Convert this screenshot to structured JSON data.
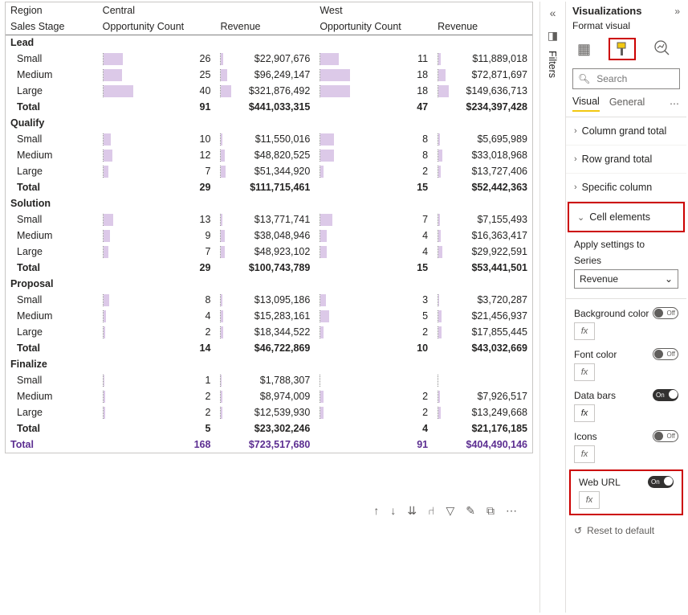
{
  "matrix": {
    "header": {
      "region_label": "Region",
      "salesstage_label": "Sales Stage",
      "regions": [
        "Central",
        "West"
      ],
      "measures": [
        "Opportunity Count",
        "Revenue"
      ]
    },
    "groups": [
      {
        "name": "Lead",
        "rows": [
          {
            "label": "Small",
            "c_opp": 26,
            "c_rev": "$22,907,676",
            "w_opp": 11,
            "w_rev": "$11,889,018",
            "c_opp_pct": 65,
            "c_rev_pct": 22,
            "w_opp_pct": 61,
            "w_rev_pct": 25
          },
          {
            "label": "Medium",
            "c_opp": 25,
            "c_rev": "$96,249,147",
            "w_opp": 18,
            "w_rev": "$72,871,697",
            "c_opp_pct": 63,
            "c_rev_pct": 55,
            "w_opp_pct": 100,
            "w_rev_pct": 70
          },
          {
            "label": "Large",
            "c_opp": 40,
            "c_rev": "$321,876,492",
            "w_opp": 18,
            "w_rev": "$149,636,713",
            "c_opp_pct": 100,
            "c_rev_pct": 100,
            "w_opp_pct": 100,
            "w_rev_pct": 100
          }
        ],
        "total": {
          "label": "Total",
          "c_opp": "91",
          "c_rev": "$441,033,315",
          "w_opp": "47",
          "w_rev": "$234,397,428"
        }
      },
      {
        "name": "Qualify",
        "rows": [
          {
            "label": "Small",
            "c_opp": 10,
            "c_rev": "$11,550,016",
            "w_opp": 8,
            "w_rev": "$5,695,989",
            "c_opp_pct": 25,
            "c_rev_pct": 12,
            "w_opp_pct": 44,
            "w_rev_pct": 12
          },
          {
            "label": "Medium",
            "c_opp": 12,
            "c_rev": "$48,820,525",
            "w_opp": 8,
            "w_rev": "$33,018,968",
            "c_opp_pct": 30,
            "c_rev_pct": 38,
            "w_opp_pct": 44,
            "w_rev_pct": 40
          },
          {
            "label": "Large",
            "c_opp": 7,
            "c_rev": "$51,344,920",
            "w_opp": 2,
            "w_rev": "$13,727,406",
            "c_opp_pct": 18,
            "c_rev_pct": 40,
            "w_opp_pct": 11,
            "w_rev_pct": 20
          }
        ],
        "total": {
          "label": "Total",
          "c_opp": "29",
          "c_rev": "$111,715,461",
          "w_opp": "15",
          "w_rev": "$52,442,363"
        }
      },
      {
        "name": "Solution",
        "rows": [
          {
            "label": "Small",
            "c_opp": 13,
            "c_rev": "$13,771,741",
            "w_opp": 7,
            "w_rev": "$7,155,493",
            "c_opp_pct": 33,
            "c_rev_pct": 14,
            "w_opp_pct": 39,
            "w_rev_pct": 14
          },
          {
            "label": "Medium",
            "c_opp": 9,
            "c_rev": "$38,048,946",
            "w_opp": 4,
            "w_rev": "$16,363,417",
            "c_opp_pct": 23,
            "c_rev_pct": 32,
            "w_opp_pct": 22,
            "w_rev_pct": 25
          },
          {
            "label": "Large",
            "c_opp": 7,
            "c_rev": "$48,923,102",
            "w_opp": 4,
            "w_rev": "$29,922,591",
            "c_opp_pct": 18,
            "c_rev_pct": 38,
            "w_opp_pct": 22,
            "w_rev_pct": 40
          }
        ],
        "total": {
          "label": "Total",
          "c_opp": "29",
          "c_rev": "$100,743,789",
          "w_opp": "15",
          "w_rev": "$53,441,501"
        }
      },
      {
        "name": "Proposal",
        "rows": [
          {
            "label": "Small",
            "c_opp": 8,
            "c_rev": "$13,095,186",
            "w_opp": 3,
            "w_rev": "$3,720,287",
            "c_opp_pct": 20,
            "c_rev_pct": 14,
            "w_opp_pct": 17,
            "w_rev_pct": 10
          },
          {
            "label": "Medium",
            "c_opp": 4,
            "c_rev": "$15,283,161",
            "w_opp": 5,
            "w_rev": "$21,456,937",
            "c_opp_pct": 10,
            "c_rev_pct": 16,
            "w_opp_pct": 28,
            "w_rev_pct": 30
          },
          {
            "label": "Large",
            "c_opp": 2,
            "c_rev": "$18,344,522",
            "w_opp": 2,
            "w_rev": "$17,855,445",
            "c_opp_pct": 5,
            "c_rev_pct": 18,
            "w_opp_pct": 11,
            "w_rev_pct": 28
          }
        ],
        "total": {
          "label": "Total",
          "c_opp": "14",
          "c_rev": "$46,722,869",
          "w_opp": "10",
          "w_rev": "$43,032,669"
        }
      },
      {
        "name": "Finalize",
        "rows": [
          {
            "label": "Small",
            "c_opp": 1,
            "c_rev": "$1,788,307",
            "w_opp": "",
            "w_rev": "",
            "c_opp_pct": 3,
            "c_rev_pct": 4,
            "w_opp_pct": 0,
            "w_rev_pct": 0
          },
          {
            "label": "Medium",
            "c_opp": 2,
            "c_rev": "$8,974,009",
            "w_opp": 2,
            "w_rev": "$7,926,517",
            "c_opp_pct": 5,
            "c_rev_pct": 10,
            "w_opp_pct": 11,
            "w_rev_pct": 16
          },
          {
            "label": "Large",
            "c_opp": 2,
            "c_rev": "$12,539,930",
            "w_opp": 2,
            "w_rev": "$13,249,668",
            "c_opp_pct": 5,
            "c_rev_pct": 13,
            "w_opp_pct": 11,
            "w_rev_pct": 20
          }
        ],
        "total": {
          "label": "Total",
          "c_opp": "5",
          "c_rev": "$23,302,246",
          "w_opp": "4",
          "w_rev": "$21,176,185"
        }
      }
    ],
    "grand_total": {
      "label": "Total",
      "c_opp": "168",
      "c_rev": "$723,517,680",
      "w_opp": "91",
      "w_rev": "$404,490,146"
    }
  },
  "filters": {
    "label": "Filters"
  },
  "viz": {
    "title": "Visualizations",
    "subtitle": "Format visual",
    "search_placeholder": "Search",
    "tabs": {
      "visual": "Visual",
      "general": "General"
    },
    "cards": {
      "col_grand_total": "Column grand total",
      "row_grand_total": "Row grand total",
      "specific_column": "Specific column",
      "cell_elements": "Cell elements"
    },
    "apply": {
      "title": "Apply settings to",
      "series_label": "Series",
      "series_value": "Revenue"
    },
    "toggles": {
      "bg_color": "Background color",
      "font_color": "Font color",
      "data_bars": "Data bars",
      "icons": "Icons",
      "web_url": "Web URL",
      "on": "On",
      "off": "Off",
      "fx": "fx"
    },
    "reset": "Reset to default"
  }
}
